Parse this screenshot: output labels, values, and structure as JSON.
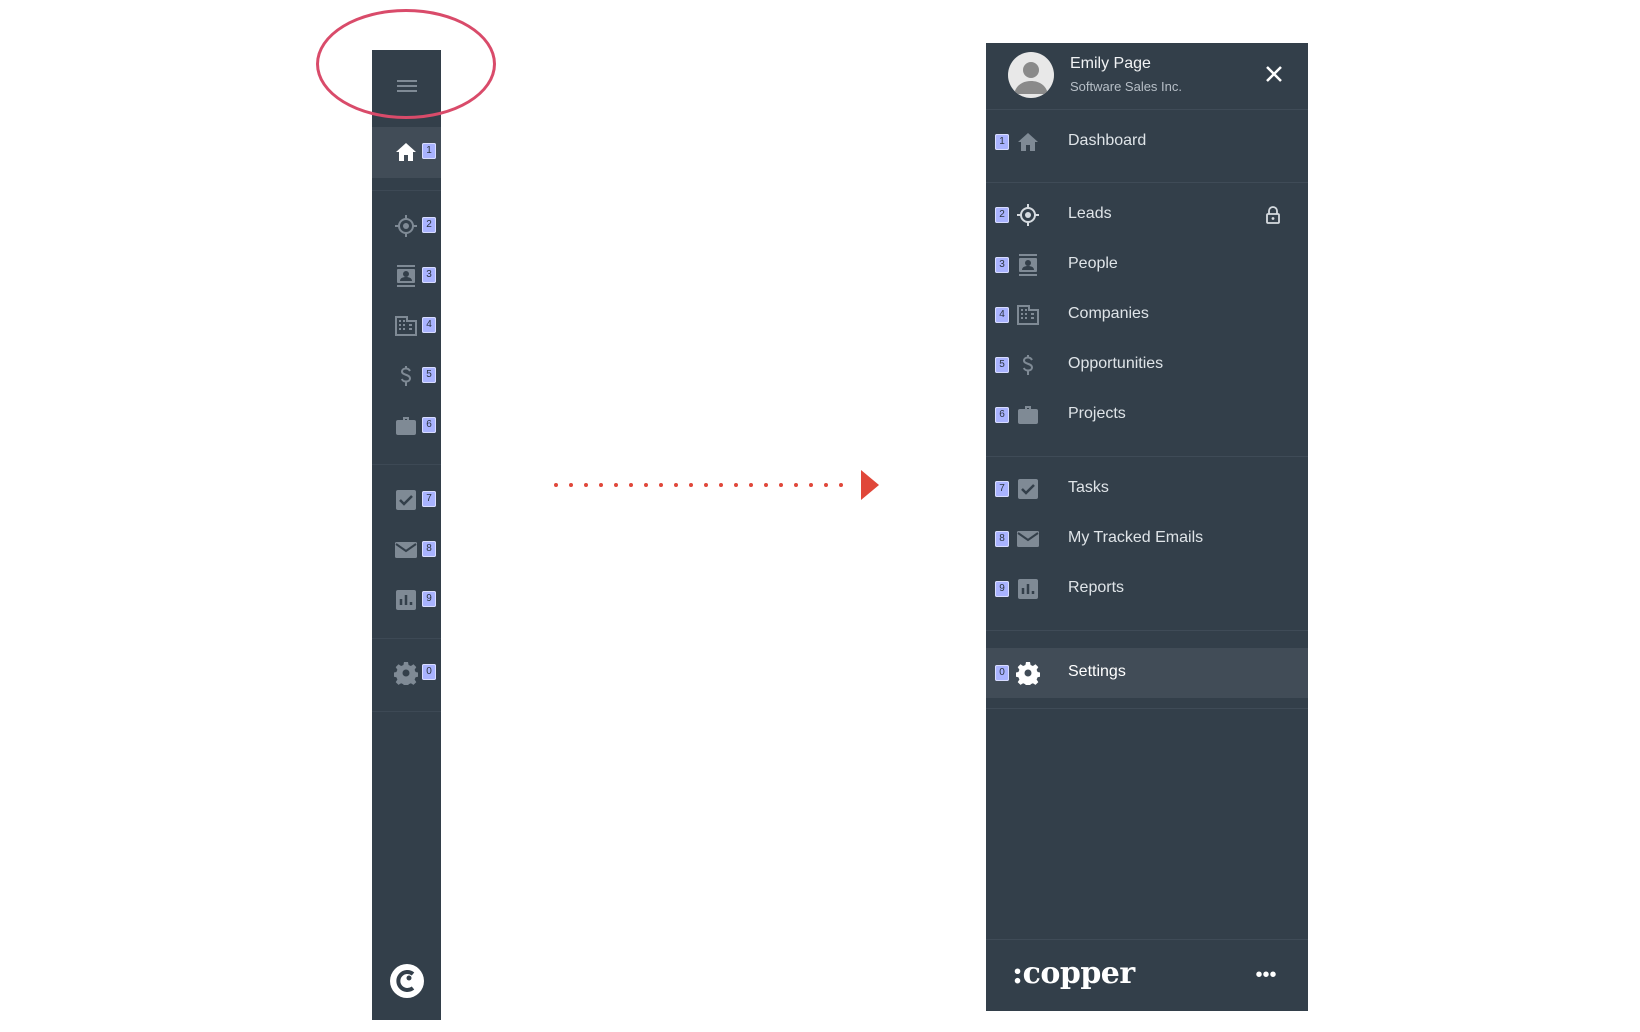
{
  "user": {
    "name": "Emily Page",
    "company": "Software Sales Inc."
  },
  "nav": [
    {
      "key": "1",
      "label": "Dashboard",
      "icon": "home-icon",
      "active_in_rail": true
    },
    {
      "key": "2",
      "label": "Leads",
      "icon": "target-icon",
      "locked": true
    },
    {
      "key": "3",
      "label": "People",
      "icon": "contact-card-icon"
    },
    {
      "key": "4",
      "label": "Companies",
      "icon": "building-icon"
    },
    {
      "key": "5",
      "label": "Opportunities",
      "icon": "dollar-icon"
    },
    {
      "key": "6",
      "label": "Projects",
      "icon": "briefcase-icon"
    },
    {
      "key": "7",
      "label": "Tasks",
      "icon": "checkbox-icon"
    },
    {
      "key": "8",
      "label": "My Tracked Emails",
      "icon": "envelope-icon"
    },
    {
      "key": "9",
      "label": "Reports",
      "icon": "bar-chart-icon"
    },
    {
      "key": "0",
      "label": "Settings",
      "icon": "gear-icon",
      "active_in_panel": true
    }
  ],
  "footer": {
    "brand": ":copper",
    "more_label": "•••"
  },
  "colors": {
    "sidebar_bg": "#333f4a",
    "key_badge": "#a9b3ff",
    "highlight_circle": "#d94b6a",
    "arrow": "#e0473a"
  }
}
